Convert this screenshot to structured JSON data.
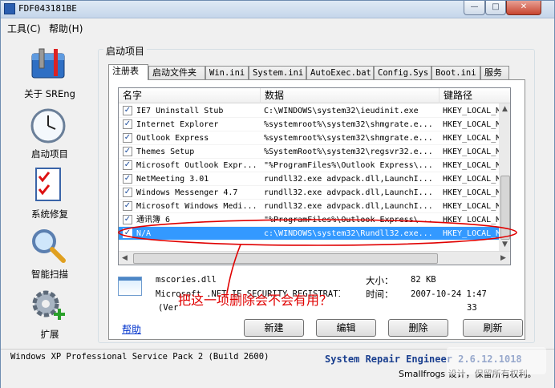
{
  "window": {
    "title": "FDF043181BE",
    "controls": {
      "minimize": "—",
      "maximize": "□",
      "close": "✕"
    }
  },
  "menu": {
    "tools": "工具(C)",
    "help": "帮助(H)"
  },
  "sidebar": {
    "items": [
      {
        "label": "关于 SREng",
        "icon": "toolbox-icon"
      },
      {
        "label": "启动项目",
        "icon": "clock-icon"
      },
      {
        "label": "系统修复",
        "icon": "checklist-icon"
      },
      {
        "label": "智能扫描",
        "icon": "magnifier-icon"
      },
      {
        "label": "扩展",
        "icon": "gear-plus-icon"
      }
    ]
  },
  "group_title": "启动项目",
  "tabs": [
    "注册表",
    "启动文件夹",
    "Win.ini",
    "System.ini",
    "AutoExec.bat",
    "Config.Sys",
    "Boot.ini",
    "服务"
  ],
  "list": {
    "columns": [
      "名字",
      "数据",
      "键路径"
    ],
    "rows": [
      {
        "name": "IE7 Uninstall Stub",
        "data": "C:\\WINDOWS\\system32\\ieudinit.exe",
        "key": "HKEY_LOCAL_MAC",
        "checked": true,
        "selected": false
      },
      {
        "name": "Internet Explorer",
        "data": "%systemroot%\\system32\\shmgrate.e...",
        "key": "HKEY_LOCAL_MAC",
        "checked": true,
        "selected": false
      },
      {
        "name": "Outlook Express",
        "data": "%systemroot%\\system32\\shmgrate.e...",
        "key": "HKEY_LOCAL_MAC",
        "checked": true,
        "selected": false
      },
      {
        "name": "Themes Setup",
        "data": "%SystemRoot%\\system32\\regsvr32.e...",
        "key": "HKEY_LOCAL_MAC",
        "checked": true,
        "selected": false
      },
      {
        "name": "Microsoft Outlook Expr...",
        "data": "\"%ProgramFiles%\\Outlook Express\\...",
        "key": "HKEY_LOCAL_MAC",
        "checked": true,
        "selected": false
      },
      {
        "name": "NetMeeting 3.01",
        "data": "rundll32.exe advpack.dll,LaunchI...",
        "key": "HKEY_LOCAL_MAC",
        "checked": true,
        "selected": false
      },
      {
        "name": "Windows Messenger 4.7",
        "data": "rundll32.exe advpack.dll,LaunchI...",
        "key": "HKEY_LOCAL_MAC",
        "checked": true,
        "selected": false
      },
      {
        "name": "Microsoft Windows Medi...",
        "data": "rundll32.exe advpack.dll,LaunchI...",
        "key": "HKEY_LOCAL_MAC",
        "checked": true,
        "selected": false
      },
      {
        "name": "通讯簿 6",
        "data": "\"%ProgramFiles%\\Outlook Express\\...",
        "key": "HKEY_LOCAL_MAC",
        "checked": true,
        "selected": false
      },
      {
        "name": "N/A",
        "data": "c:\\WINDOWS\\system32\\Rundll32.exe...",
        "key": "HKEY_LOCAL_MAC",
        "checked": true,
        "selected": true
      }
    ]
  },
  "details": {
    "file": "mscories.dll",
    "line2": "Microsoft .NET IE SECURITY REGISTRATION",
    "line3": "(Ver",
    "size_label": "大小：",
    "size_value": "82 KB",
    "time_label": "时间：",
    "time_value": "2007-10-24 1:47",
    "extra_value": "33"
  },
  "buttons": {
    "new": "新建",
    "edit": "编辑",
    "delete": "删除",
    "refresh": "刷新"
  },
  "help_link": "帮助",
  "status": {
    "os": "Windows XP Professional Service Pack 2 (Build 2600)",
    "brand": "System Repair Engineer 2.6.12.1018",
    "copyright": "Smallfrogs 设计，保留所有权利。"
  },
  "annotation": {
    "text": "把这一项删除会不会有用？",
    "color": "#e00000"
  }
}
